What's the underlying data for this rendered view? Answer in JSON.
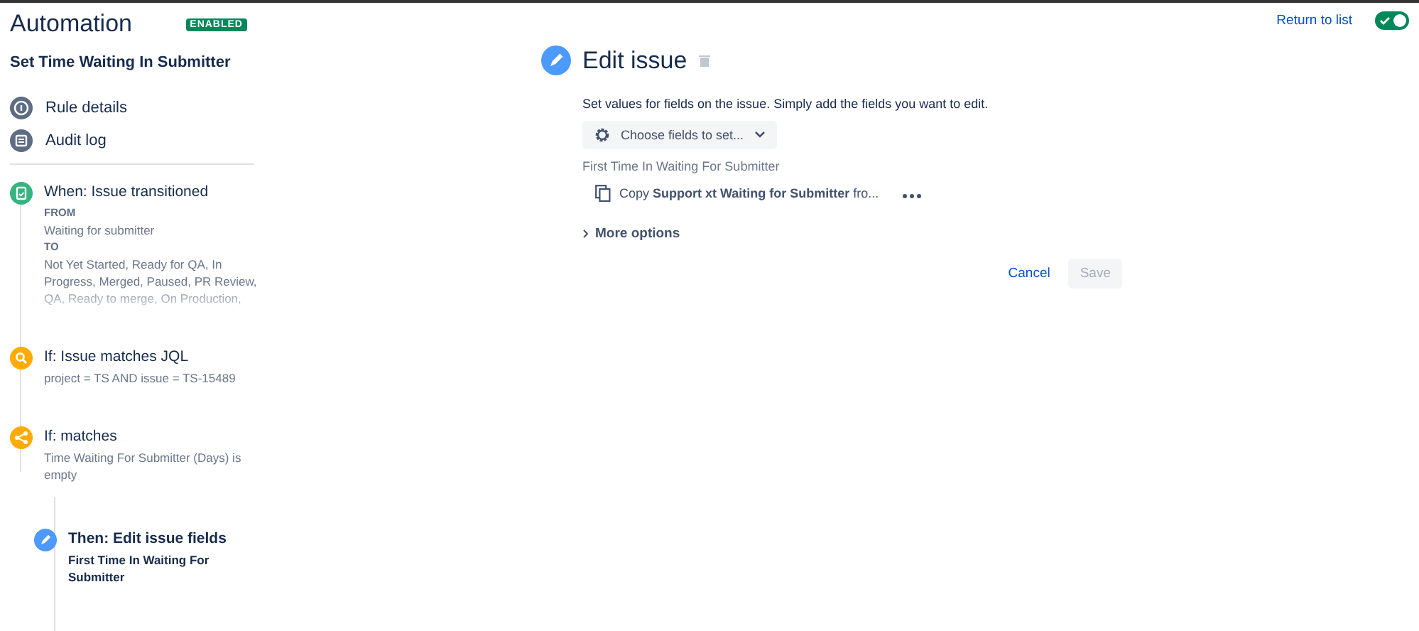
{
  "header": {
    "title": "Automation",
    "status_badge": "ENABLED",
    "return_link": "Return to list",
    "toggle": {
      "on": true
    }
  },
  "rule": {
    "name": "Set Time Waiting In Submitter",
    "menu": [
      {
        "kind": "info",
        "label": "Rule details"
      },
      {
        "kind": "log",
        "label": "Audit log"
      }
    ],
    "steps": [
      {
        "kind": "trigger",
        "title": "When: Issue transitioned",
        "details": [
          {
            "label": "FROM",
            "value": "Waiting for submitter"
          },
          {
            "label": "TO",
            "value": "Not Yet Started, Ready for QA, In Progress, Merged, Paused, PR Review, QA, Ready to merge, On Production,"
          }
        ]
      },
      {
        "kind": "condition",
        "title": "If: Issue matches JQL",
        "description": "project = TS AND issue = TS-15489"
      },
      {
        "kind": "branch",
        "title": "If: matches",
        "description": "Time Waiting For Submitter (Days) is empty",
        "children": [
          {
            "kind": "action",
            "title": "Then: Edit issue fields",
            "description": "First Time In Waiting For Submitter",
            "selected": true
          }
        ]
      }
    ]
  },
  "editor": {
    "title": "Edit issue",
    "description": "Set values for fields on the issue. Simply add the fields you want to edit.",
    "choose_button": "Choose fields to set...",
    "field_label": "First Time In Waiting For Submitter",
    "field_value": "Copy **Support xt Waiting for Submitter** fro...",
    "more_options": "More options",
    "cancel": "Cancel",
    "save": {
      "label": "Save",
      "disabled": true
    }
  }
}
